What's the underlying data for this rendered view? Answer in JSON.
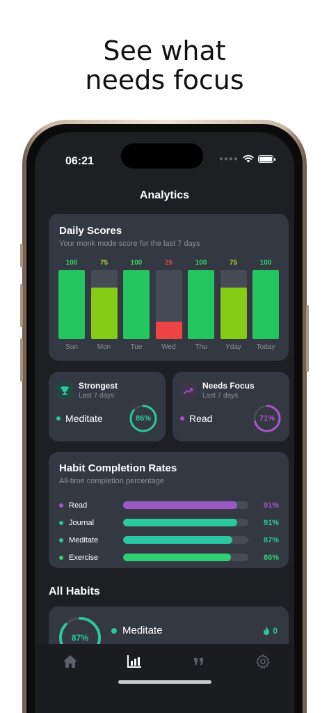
{
  "headline": {
    "line1": "See what",
    "line2": "needs focus"
  },
  "status_bar": {
    "time": "06:21"
  },
  "nav": {
    "title": "Analytics"
  },
  "daily_scores": {
    "title": "Daily Scores",
    "subtitle": "Your monk mode score for the last 7 days",
    "chart_data": {
      "type": "bar",
      "categories": [
        "Sun",
        "Mon",
        "Tue",
        "Wed",
        "Thu",
        "Yday",
        "Today"
      ],
      "values": [
        100,
        75,
        100,
        25,
        100,
        75,
        100
      ],
      "ylim": [
        0,
        100
      ],
      "colors": [
        "#22c55e",
        "#84cc16",
        "#22c55e",
        "#ef4444",
        "#22c55e",
        "#84cc16",
        "#22c55e"
      ],
      "label_colors": [
        "#34d36b",
        "#a3d62a",
        "#34d36b",
        "#ef4444",
        "#34d36b",
        "#a3d62a",
        "#34d36b"
      ]
    },
    "labels": {
      "v0": "100",
      "v1": "75",
      "v2": "100",
      "v3": "25",
      "v4": "100",
      "v5": "75",
      "v6": "100",
      "d0": "Sun",
      "d1": "Mon",
      "d2": "Tue",
      "d3": "Wed",
      "d4": "Thu",
      "d5": "Yday",
      "d6": "Today"
    }
  },
  "strongest": {
    "title": "Strongest",
    "subtitle": "Last 7 days",
    "habit": "Meditate",
    "percent": 86,
    "percent_label": "86%",
    "color": "#2bc7a1",
    "icon": "trophy-icon"
  },
  "needs_focus": {
    "title": "Needs Focus",
    "subtitle": "Last 7 days",
    "habit": "Read",
    "percent": 71,
    "percent_label": "71%",
    "color": "#a855c7",
    "icon": "trend-up-icon"
  },
  "completion_rates": {
    "title": "Habit Completion Rates",
    "subtitle": "All-time completion percentage",
    "items": [
      {
        "name": "Read",
        "value": 91,
        "label": "91%",
        "color": "#9b59c6"
      },
      {
        "name": "Journal",
        "value": 91,
        "label": "91%",
        "color": "#2bc7a1"
      },
      {
        "name": "Meditate",
        "value": 87,
        "label": "87%",
        "color": "#2bc7a1"
      },
      {
        "name": "Exercise",
        "value": 86,
        "label": "86%",
        "color": "#2fcf74"
      }
    ]
  },
  "all_habits": {
    "title": "All Habits",
    "first": {
      "name": "Meditate",
      "percent": 87,
      "percent_label": "87%",
      "streak": "0",
      "streak_icon": "flame-icon",
      "color": "#2bc7a1"
    }
  },
  "tabs": [
    {
      "name": "home-icon",
      "active": false
    },
    {
      "name": "chart-icon",
      "active": true
    },
    {
      "name": "quote-icon",
      "active": false
    },
    {
      "name": "gear-icon",
      "active": false
    }
  ]
}
